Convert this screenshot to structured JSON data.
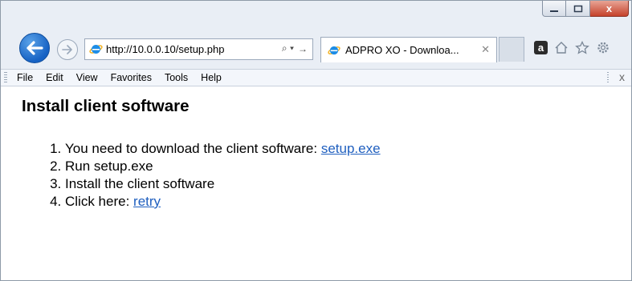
{
  "browser": {
    "address": {
      "url": "http://10.0.0.10/setup.php",
      "search_glyph": "⌕ ▾",
      "go_glyph": "→"
    },
    "tab": {
      "title": "ADPRO XO - Downloa...",
      "close_glyph": "✕"
    },
    "amazon_label": "a",
    "close_glyph": "x",
    "menu": [
      "File",
      "Edit",
      "View",
      "Favorites",
      "Tools",
      "Help"
    ],
    "menu_close_glyph": "x"
  },
  "page": {
    "heading": "Install client software",
    "steps": [
      {
        "text": "You need to download the client software: ",
        "link": "setup.exe"
      },
      {
        "text": "Run setup.exe"
      },
      {
        "text": "Install the client software"
      },
      {
        "text": "Click here: ",
        "link": "retry"
      }
    ]
  },
  "colors": {
    "accent": "#1662c4",
    "link": "#1f5fbf",
    "close": "#c5422b",
    "chrome": "#e9eef5"
  }
}
